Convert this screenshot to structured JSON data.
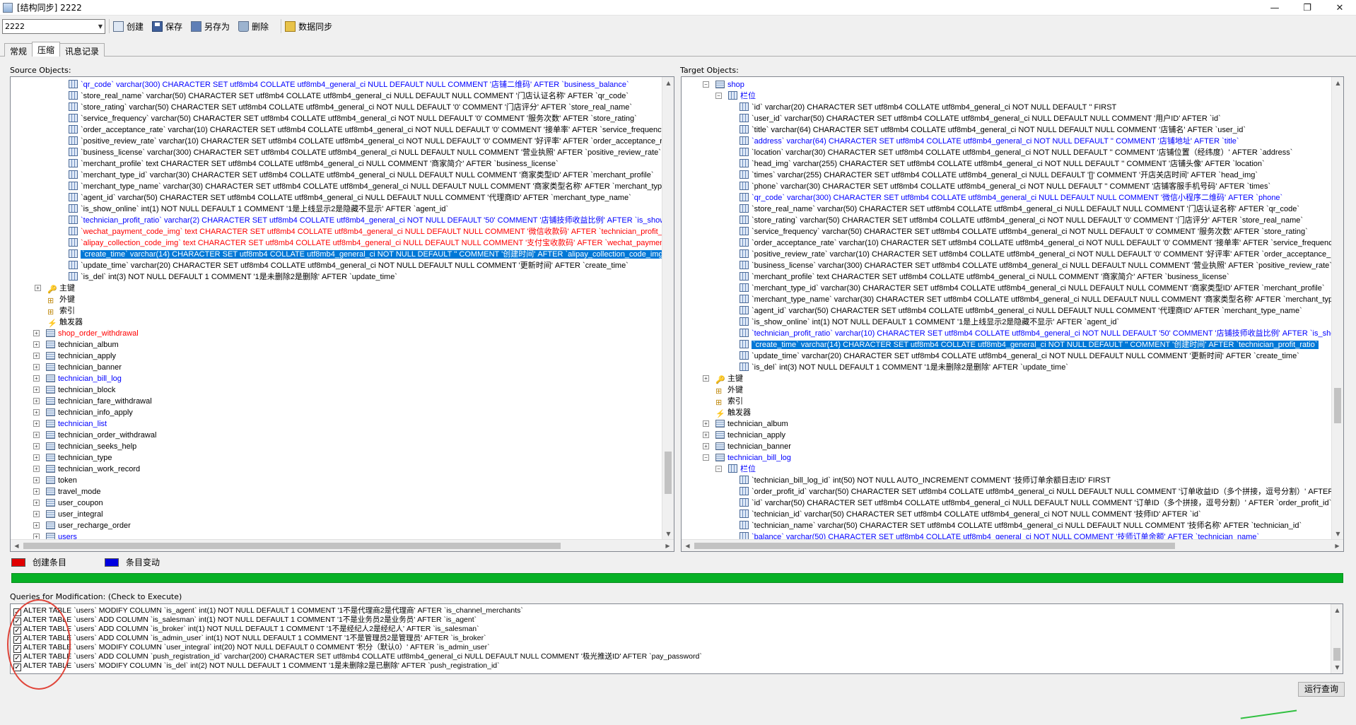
{
  "window": {
    "title": "[结构同步] 2222",
    "min": "—",
    "restore": "❐",
    "close": "✕"
  },
  "toolbar": {
    "profile": "2222",
    "buttons": [
      {
        "label": "创建",
        "icon": "new-icon"
      },
      {
        "label": "保存",
        "icon": "save-icon"
      },
      {
        "label": "另存为",
        "icon": "save-as-icon"
      },
      {
        "label": "删除",
        "icon": "delete-icon"
      },
      {
        "label": "数据同步",
        "icon": "data-sync-icon"
      }
    ]
  },
  "tabs": [
    "常规",
    "压缩",
    "讯息记录"
  ],
  "active_tab": "压缩",
  "source": {
    "label": "Source Objects:",
    "rows": [
      {
        "text": "`qr_code` varchar(300) CHARACTER SET utf8mb4 COLLATE utf8mb4_general_ci NULL DEFAULT NULL COMMENT '店铺二维码' AFTER `business_balance`",
        "kind": "col",
        "color": "blue"
      },
      {
        "text": "`store_real_name` varchar(50) CHARACTER SET utf8mb4 COLLATE utf8mb4_general_ci NULL DEFAULT NULL COMMENT '门店认证名称' AFTER `qr_code`",
        "kind": "col"
      },
      {
        "text": "`store_rating` varchar(50) CHARACTER SET utf8mb4 COLLATE utf8mb4_general_ci NOT NULL DEFAULT '0' COMMENT '门店评分' AFTER `store_real_name`",
        "kind": "col"
      },
      {
        "text": "`service_frequency` varchar(50) CHARACTER SET utf8mb4 COLLATE utf8mb4_general_ci NOT NULL DEFAULT '0' COMMENT '服务次数' AFTER `store_rating`",
        "kind": "col"
      },
      {
        "text": "`order_acceptance_rate` varchar(10) CHARACTER SET utf8mb4 COLLATE utf8mb4_general_ci NOT NULL DEFAULT '0' COMMENT '接单率' AFTER `service_frequency`",
        "kind": "col"
      },
      {
        "text": "`positive_review_rate` varchar(10) CHARACTER SET utf8mb4 COLLATE utf8mb4_general_ci NOT NULL DEFAULT '0' COMMENT '好评率' AFTER `order_acceptance_rate`",
        "kind": "col"
      },
      {
        "text": "`business_license` varchar(300) CHARACTER SET utf8mb4 COLLATE utf8mb4_general_ci NULL DEFAULT NULL COMMENT '营业执照' AFTER `positive_review_rate`",
        "kind": "col"
      },
      {
        "text": "`merchant_profile` text CHARACTER SET utf8mb4 COLLATE utf8mb4_general_ci NULL COMMENT '商家简介' AFTER `business_license`",
        "kind": "col"
      },
      {
        "text": "`merchant_type_id` varchar(30) CHARACTER SET utf8mb4 COLLATE utf8mb4_general_ci NULL DEFAULT NULL COMMENT '商家类型ID' AFTER `merchant_profile`",
        "kind": "col"
      },
      {
        "text": "`merchant_type_name` varchar(30) CHARACTER SET utf8mb4 COLLATE utf8mb4_general_ci NULL DEFAULT NULL COMMENT '商家类型名称' AFTER `merchant_type_id`",
        "kind": "col"
      },
      {
        "text": "`agent_id` varchar(50) CHARACTER SET utf8mb4 COLLATE utf8mb4_general_ci NULL DEFAULT NULL COMMENT '代理商ID' AFTER `merchant_type_name`",
        "kind": "col"
      },
      {
        "text": "`is_show_online` int(1) NOT NULL DEFAULT 1 COMMENT '1是上线显示2是隐藏不显示' AFTER `agent_id`",
        "kind": "col"
      },
      {
        "text": "`technician_profit_ratio` varchar(2) CHARACTER SET utf8mb4 COLLATE utf8mb4_general_ci NOT NULL DEFAULT '50' COMMENT '店铺技师收益比例' AFTER `is_show_online`",
        "kind": "col",
        "color": "blue"
      },
      {
        "text": "`wechat_payment_code_img` text CHARACTER SET utf8mb4 COLLATE utf8mb4_general_ci NULL DEFAULT NULL COMMENT '微信收款码' AFTER `technician_profit_ratio`",
        "kind": "col",
        "color": "red"
      },
      {
        "text": "`alipay_collection_code_img` text CHARACTER SET utf8mb4 COLLATE utf8mb4_general_ci NULL DEFAULT NULL COMMENT '支付宝收款码' AFTER `wechat_payment_code_img`",
        "kind": "col",
        "color": "red"
      },
      {
        "text": "`create_time` varchar(14) CHARACTER SET utf8mb4 COLLATE utf8mb4_general_ci NOT NULL DEFAULT '' COMMENT '创建时间' AFTER `alipay_collection_code_img`",
        "kind": "col",
        "sel": true
      },
      {
        "text": "`update_time` varchar(20) CHARACTER SET utf8mb4 COLLATE utf8mb4_general_ci NOT NULL DEFAULT NULL COMMENT '更新时间' AFTER `create_time`",
        "kind": "col"
      },
      {
        "text": "`is_del` int(3) NOT NULL DEFAULT 1 COMMENT '1是未删除2是删除' AFTER `update_time`",
        "kind": "col"
      },
      {
        "text": "主键",
        "kind": "key",
        "indent": 1,
        "exp": "+"
      },
      {
        "text": "外键",
        "kind": "key",
        "indent": 1
      },
      {
        "text": "索引",
        "kind": "key",
        "indent": 1
      },
      {
        "text": "触发器",
        "kind": "key",
        "indent": 1
      },
      {
        "text": "shop_order_withdrawal",
        "kind": "table",
        "color": "red"
      },
      {
        "text": "technician_album",
        "kind": "table"
      },
      {
        "text": "technician_apply",
        "kind": "table"
      },
      {
        "text": "technician_banner",
        "kind": "table"
      },
      {
        "text": "technician_bill_log",
        "kind": "table",
        "color": "blue"
      },
      {
        "text": "technician_block",
        "kind": "table"
      },
      {
        "text": "technician_fare_withdrawal",
        "kind": "table"
      },
      {
        "text": "technician_info_apply",
        "kind": "table"
      },
      {
        "text": "technician_list",
        "kind": "table",
        "color": "blue"
      },
      {
        "text": "technician_order_withdrawal",
        "kind": "table"
      },
      {
        "text": "technician_seeks_help",
        "kind": "table"
      },
      {
        "text": "technician_type",
        "kind": "table"
      },
      {
        "text": "technician_work_record",
        "kind": "table"
      },
      {
        "text": "token",
        "kind": "table"
      },
      {
        "text": "travel_mode",
        "kind": "table"
      },
      {
        "text": "user_coupon",
        "kind": "table"
      },
      {
        "text": "user_integral",
        "kind": "table"
      },
      {
        "text": "user_recharge_order",
        "kind": "table"
      },
      {
        "text": "users",
        "kind": "table",
        "color": "blue"
      }
    ]
  },
  "target": {
    "label": "Target Objects:",
    "rows": [
      {
        "text": "shop",
        "kind": "table",
        "color": "blue",
        "indent": 0,
        "exp": "−"
      },
      {
        "text": "栏位",
        "kind": "folder",
        "color": "blue",
        "indent": 1,
        "exp": "−"
      },
      {
        "text": "`id` varchar(20) CHARACTER SET utf8mb4 COLLATE utf8mb4_general_ci NOT NULL DEFAULT '' FIRST",
        "kind": "col"
      },
      {
        "text": "`user_id` varchar(50) CHARACTER SET utf8mb4 COLLATE utf8mb4_general_ci NULL DEFAULT NULL COMMENT '用户ID' AFTER `id`",
        "kind": "col"
      },
      {
        "text": "`title` varchar(64) CHARACTER SET utf8mb4 COLLATE utf8mb4_general_ci NOT NULL DEFAULT NULL COMMENT '店铺名' AFTER `user_id`",
        "kind": "col"
      },
      {
        "text": "`address` varchar(64) CHARACTER SET utf8mb4 COLLATE utf8mb4_general_ci NOT NULL DEFAULT '' COMMENT '店铺地址' AFTER `title`",
        "kind": "col",
        "color": "blue"
      },
      {
        "text": "`location` varchar(30) CHARACTER SET utf8mb4 COLLATE utf8mb4_general_ci NOT NULL DEFAULT '' COMMENT '店铺位置（经纬度）' AFTER `address`",
        "kind": "col"
      },
      {
        "text": "`head_img` varchar(255) CHARACTER SET utf8mb4 COLLATE utf8mb4_general_ci NOT NULL DEFAULT '' COMMENT '店铺头像' AFTER `location`",
        "kind": "col"
      },
      {
        "text": "`times` varchar(255) CHARACTER SET utf8mb4 COLLATE utf8mb4_general_ci NULL DEFAULT '[]' COMMENT '开店关店时间' AFTER `head_img`",
        "kind": "col"
      },
      {
        "text": "`phone` varchar(30) CHARACTER SET utf8mb4 COLLATE utf8mb4_general_ci NOT NULL DEFAULT '' COMMENT '店铺客服手机号码' AFTER `times`",
        "kind": "col"
      },
      {
        "text": "`qr_code` varchar(300) CHARACTER SET utf8mb4 COLLATE utf8mb4_general_ci NULL DEFAULT NULL COMMENT '微信小程序二维码' AFTER `phone`",
        "kind": "col",
        "color": "blue"
      },
      {
        "text": "`store_real_name` varchar(50) CHARACTER SET utf8mb4 COLLATE utf8mb4_general_ci NULL DEFAULT NULL COMMENT '门店认证名称' AFTER `qr_code`",
        "kind": "col"
      },
      {
        "text": "`store_rating` varchar(50) CHARACTER SET utf8mb4 COLLATE utf8mb4_general_ci NOT NULL DEFAULT '0' COMMENT '门店评分' AFTER `store_real_name`",
        "kind": "col"
      },
      {
        "text": "`service_frequency` varchar(50) CHARACTER SET utf8mb4 COLLATE utf8mb4_general_ci NOT NULL DEFAULT '0' COMMENT '服务次数' AFTER `store_rating`",
        "kind": "col"
      },
      {
        "text": "`order_acceptance_rate` varchar(10) CHARACTER SET utf8mb4 COLLATE utf8mb4_general_ci NOT NULL DEFAULT '0' COMMENT '接单率' AFTER `service_frequency`",
        "kind": "col"
      },
      {
        "text": "`positive_review_rate` varchar(10) CHARACTER SET utf8mb4 COLLATE utf8mb4_general_ci NOT NULL DEFAULT '0' COMMENT '好评率' AFTER `order_acceptance_rate`",
        "kind": "col"
      },
      {
        "text": "`business_license` varchar(300) CHARACTER SET utf8mb4 COLLATE utf8mb4_general_ci NULL DEFAULT NULL COMMENT '营业执照' AFTER `positive_review_rate`",
        "kind": "col"
      },
      {
        "text": "`merchant_profile` text CHARACTER SET utf8mb4 COLLATE utf8mb4_general_ci NULL COMMENT '商家简介' AFTER `business_license`",
        "kind": "col"
      },
      {
        "text": "`merchant_type_id` varchar(30) CHARACTER SET utf8mb4 COLLATE utf8mb4_general_ci NULL DEFAULT NULL COMMENT '商家类型ID' AFTER `merchant_profile`",
        "kind": "col"
      },
      {
        "text": "`merchant_type_name` varchar(30) CHARACTER SET utf8mb4 COLLATE utf8mb4_general_ci NULL DEFAULT NULL COMMENT '商家类型名称' AFTER `merchant_type_id`",
        "kind": "col"
      },
      {
        "text": "`agent_id` varchar(50) CHARACTER SET utf8mb4 COLLATE utf8mb4_general_ci NULL DEFAULT NULL COMMENT '代理商ID' AFTER `merchant_type_name`",
        "kind": "col"
      },
      {
        "text": "`is_show_online` int(1) NOT NULL DEFAULT 1 COMMENT '1是上线显示2是隐藏不显示' AFTER `agent_id`",
        "kind": "col"
      },
      {
        "text": "`technician_profit_ratio` varchar(10) CHARACTER SET utf8mb4 COLLATE utf8mb4_general_ci NOT NULL DEFAULT '50' COMMENT '店铺技师收益比例' AFTER `is_show_online`",
        "kind": "col",
        "color": "blue"
      },
      {
        "text": "`create_time` varchar(14) CHARACTER SET utf8mb4 COLLATE utf8mb4_general_ci NOT NULL DEFAULT '' COMMENT '创建时间' AFTER `technician_profit_ratio`",
        "kind": "col",
        "sel": true
      },
      {
        "text": "`update_time` varchar(20) CHARACTER SET utf8mb4 COLLATE utf8mb4_general_ci NOT NULL DEFAULT NULL COMMENT '更新时间' AFTER `create_time`",
        "kind": "col"
      },
      {
        "text": "`is_del` int(3) NOT NULL DEFAULT 1 COMMENT '1是未删除2是删除' AFTER `update_time`",
        "kind": "col"
      },
      {
        "text": "主键",
        "kind": "key",
        "indent": 1,
        "exp": "+"
      },
      {
        "text": "外键",
        "kind": "key",
        "indent": 1
      },
      {
        "text": "索引",
        "kind": "key",
        "indent": 1
      },
      {
        "text": "触发器",
        "kind": "key",
        "indent": 1
      },
      {
        "text": "technician_album",
        "kind": "table",
        "indent": 0
      },
      {
        "text": "technician_apply",
        "kind": "table",
        "indent": 0
      },
      {
        "text": "technician_banner",
        "kind": "table",
        "indent": 0
      },
      {
        "text": "technician_bill_log",
        "kind": "table",
        "color": "blue",
        "indent": 0,
        "exp": "−"
      },
      {
        "text": "栏位",
        "kind": "folder",
        "color": "blue",
        "indent": 1,
        "exp": "−"
      },
      {
        "text": "`technician_bill_log_id` int(50) NOT NULL AUTO_INCREMENT COMMENT '技师订单余额日志ID' FIRST",
        "kind": "col"
      },
      {
        "text": "`order_profit_id` varchar(50) CHARACTER SET utf8mb4 COLLATE utf8mb4_general_ci NULL DEFAULT NULL COMMENT '订单收益ID（多个拼接，逗号分割）' AFTER `technician_bill_log_id`",
        "kind": "col"
      },
      {
        "text": "`id` varchar(50) CHARACTER SET utf8mb4 COLLATE utf8mb4_general_ci NULL DEFAULT NULL COMMENT '订单ID（多个拼接，逗号分割）' AFTER `order_profit_id`",
        "kind": "col"
      },
      {
        "text": "`technician_id` varchar(50) CHARACTER SET utf8mb4 COLLATE utf8mb4_general_ci NOT NULL COMMENT '技师ID' AFTER `id`",
        "kind": "col"
      },
      {
        "text": "`technician_name` varchar(50) CHARACTER SET utf8mb4 COLLATE utf8mb4_general_ci NULL DEFAULT NULL COMMENT '技师名称' AFTER `technician_id`",
        "kind": "col"
      },
      {
        "text": "`balance` varchar(50) CHARACTER SET utf8mb4 COLLATE utf8mb4_general_ci NOT NULL COMMENT '技师订单余额' AFTER `technician_name`",
        "kind": "col",
        "color": "blue"
      }
    ]
  },
  "legend": {
    "create": "创建条目",
    "change": "条目变动",
    "create_color": "#e00000",
    "change_color": "#0000e0"
  },
  "progress": 1.0,
  "queries": {
    "label": "Queries for Modification: (Check to Execute)",
    "items": [
      "ALTER TABLE `users` MODIFY COLUMN `is_agent` int(1) NOT NULL DEFAULT 1 COMMENT '1不是代理商2是代理商' AFTER `is_channel_merchants`",
      "ALTER TABLE `users` ADD COLUMN `is_salesman` int(1) NOT NULL DEFAULT 1 COMMENT '1不是业务员2是业务员' AFTER `is_agent`",
      "ALTER TABLE `users` ADD COLUMN `is_broker` int(1) NOT NULL DEFAULT 1 COMMENT '1不是经纪人2是经纪人' AFTER `is_salesman`",
      "ALTER TABLE `users` ADD COLUMN `is_admin_user` int(1) NOT NULL DEFAULT 1 COMMENT '1不是管理员2是管理员' AFTER `is_broker`",
      "ALTER TABLE `users` MODIFY COLUMN `user_integral` int(20) NOT NULL DEFAULT 0 COMMENT '积分（默认0）' AFTER `is_admin_user`",
      "ALTER TABLE `users` ADD COLUMN `push_registration_id` varchar(200) CHARACTER SET utf8mb4 COLLATE utf8mb4_general_ci NULL DEFAULT NULL COMMENT '极光推送ID' AFTER `pay_password`",
      "ALTER TABLE `users` MODIFY COLUMN `is_del` int(2) NOT NULL DEFAULT 1 COMMENT '1是未删除2是已删除' AFTER `push_registration_id`"
    ]
  },
  "run_button": "运行查询"
}
